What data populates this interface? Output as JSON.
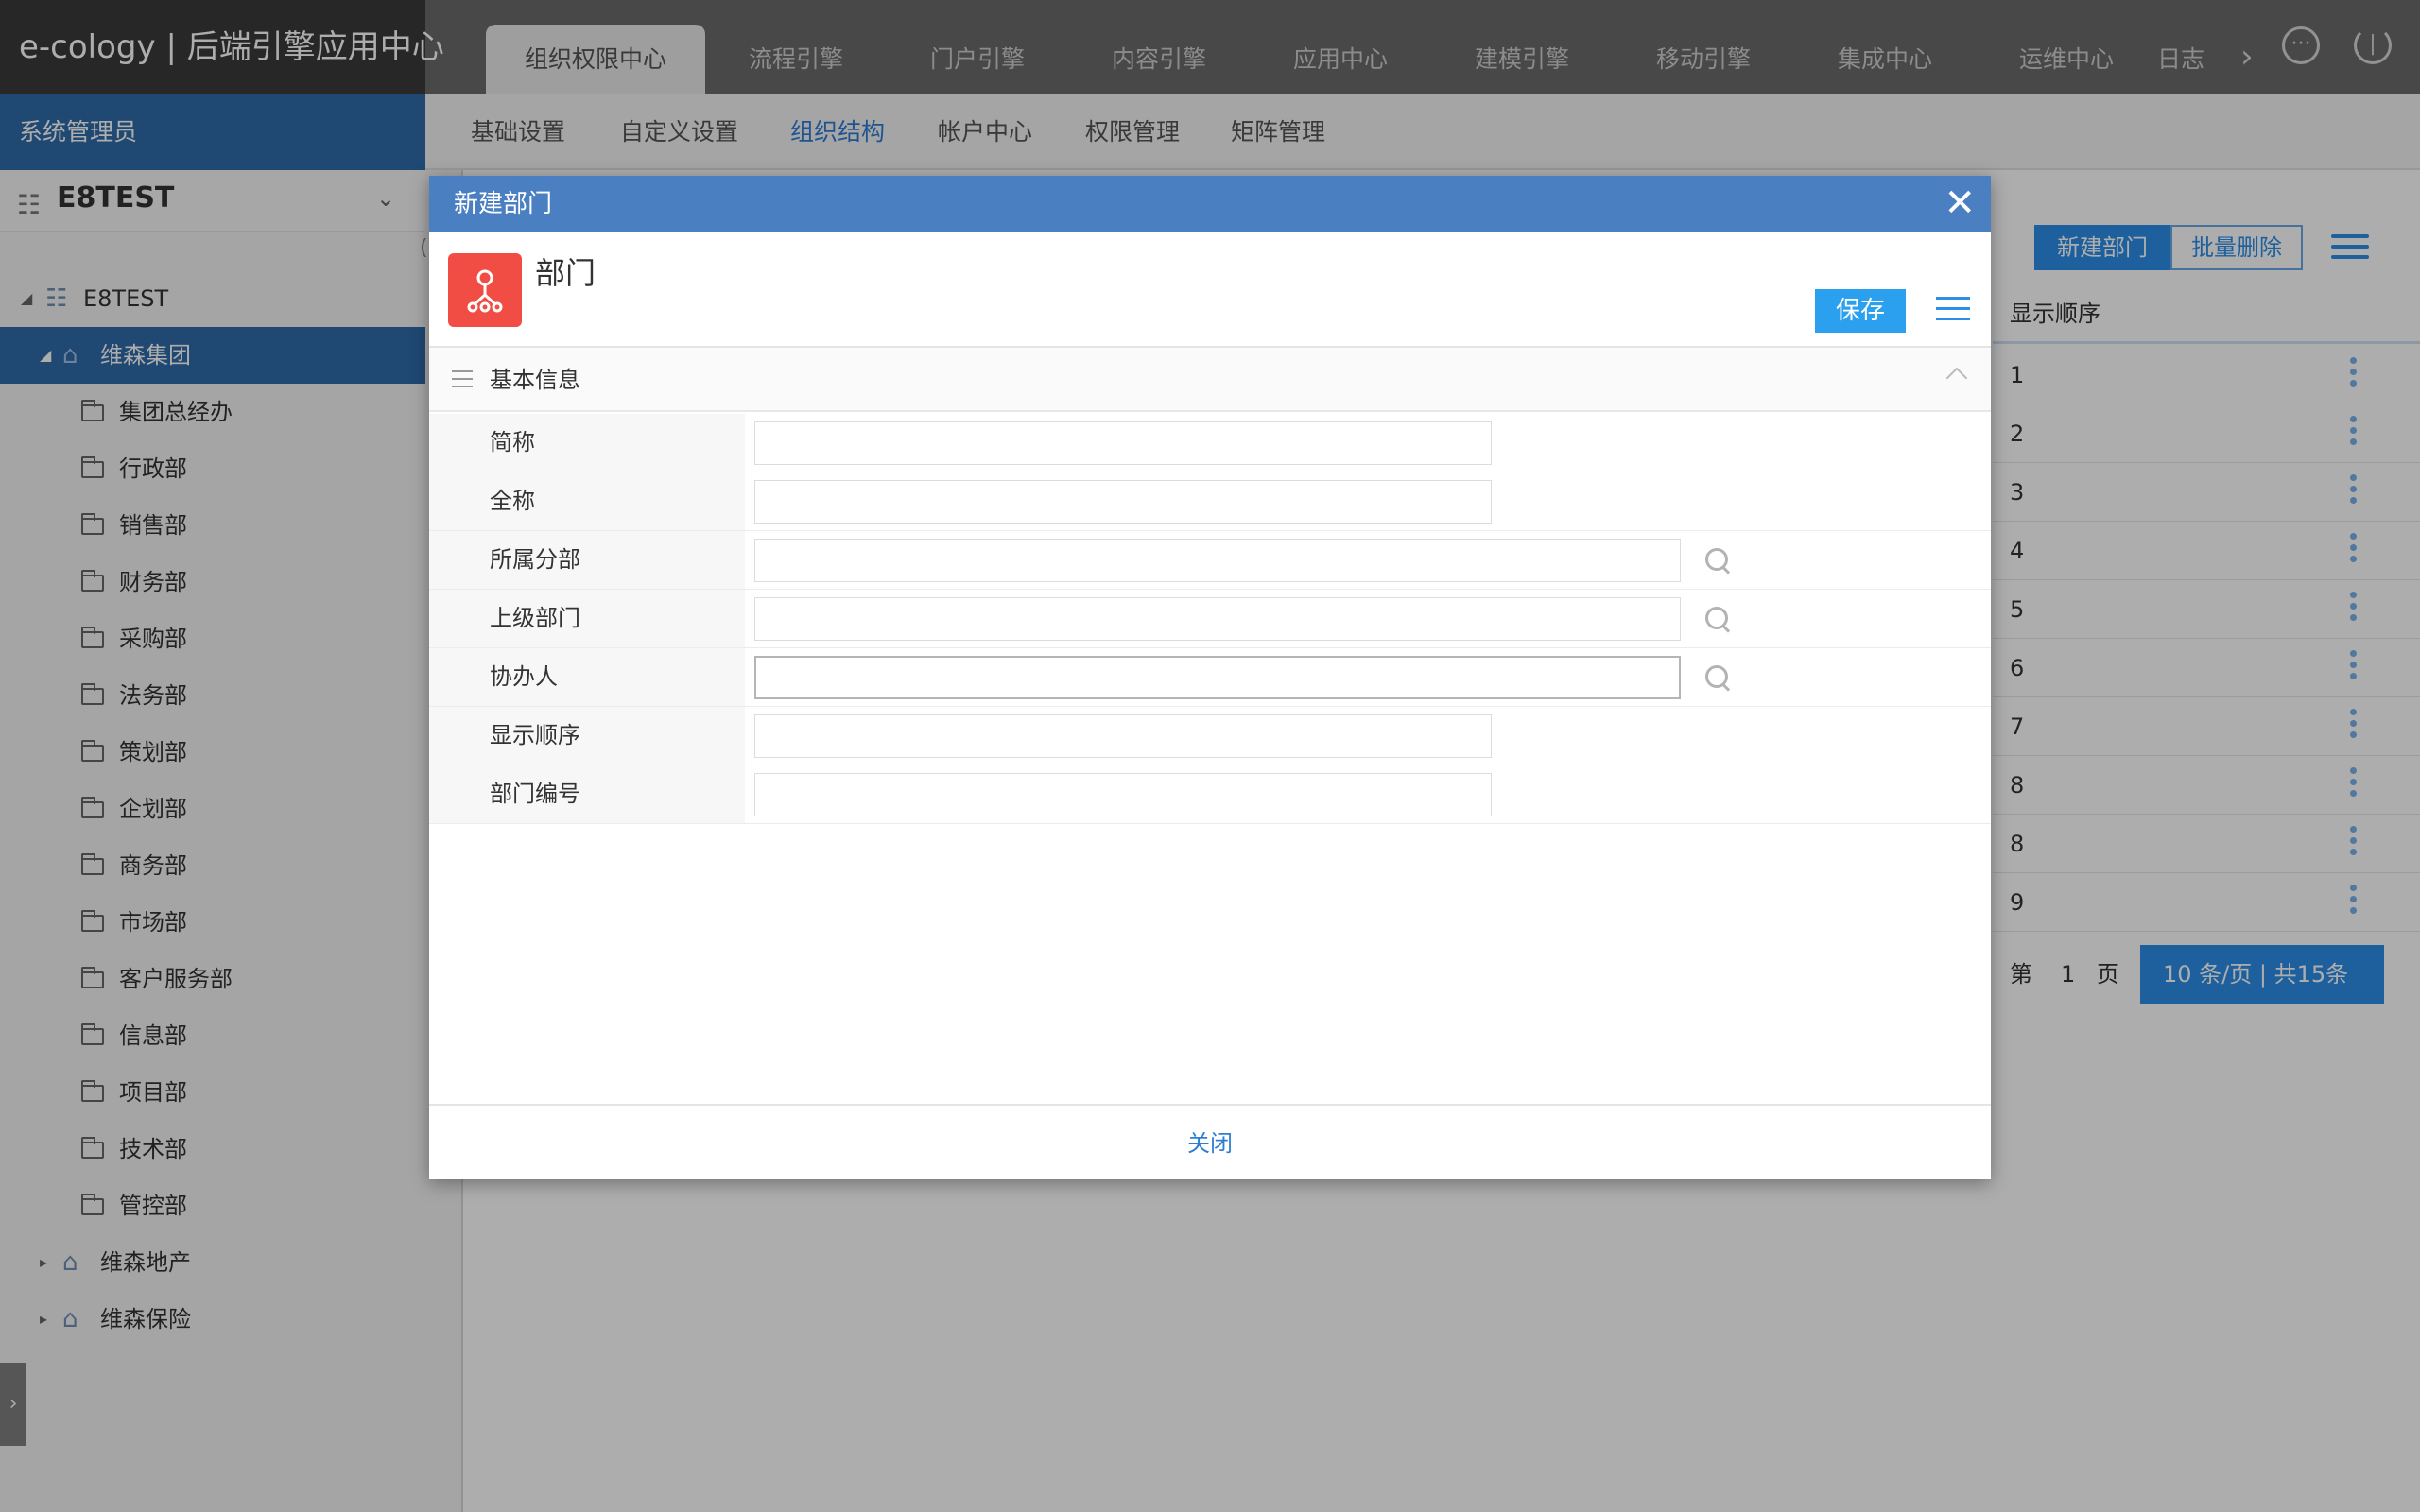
{
  "app": {
    "title": "e-cology | 后端引擎应用中心"
  },
  "topnav": {
    "tabs": [
      {
        "label": "组织权限中心",
        "active": true
      },
      {
        "label": "流程引擎"
      },
      {
        "label": "门户引擎"
      },
      {
        "label": "内容引擎"
      },
      {
        "label": "应用中心"
      },
      {
        "label": "建模引擎"
      },
      {
        "label": "移动引擎"
      },
      {
        "label": "集成中心"
      },
      {
        "label": "运维中心"
      },
      {
        "label": "日志"
      }
    ],
    "more_glyph": "›"
  },
  "sidebar": {
    "user_role": "系统管理员",
    "company": "E8TEST",
    "tree": [
      {
        "label": "E8TEST",
        "level": 0,
        "type": "org",
        "arrow": "◢"
      },
      {
        "label": "维森集团",
        "level": 1,
        "type": "home",
        "arrow": "◢",
        "selected": true
      },
      {
        "label": "集团总经办",
        "level": 2,
        "type": "folder"
      },
      {
        "label": "行政部",
        "level": 2,
        "type": "folder"
      },
      {
        "label": "销售部",
        "level": 2,
        "type": "folder"
      },
      {
        "label": "财务部",
        "level": 2,
        "type": "folder"
      },
      {
        "label": "采购部",
        "level": 2,
        "type": "folder"
      },
      {
        "label": "法务部",
        "level": 2,
        "type": "folder"
      },
      {
        "label": "策划部",
        "level": 2,
        "type": "folder"
      },
      {
        "label": "企划部",
        "level": 2,
        "type": "folder"
      },
      {
        "label": "商务部",
        "level": 2,
        "type": "folder"
      },
      {
        "label": "市场部",
        "level": 2,
        "type": "folder"
      },
      {
        "label": "客户服务部",
        "level": 2,
        "type": "folder"
      },
      {
        "label": "信息部",
        "level": 2,
        "type": "folder"
      },
      {
        "label": "项目部",
        "level": 2,
        "type": "folder"
      },
      {
        "label": "技术部",
        "level": 2,
        "type": "folder"
      },
      {
        "label": "管控部",
        "level": 2,
        "type": "folder"
      },
      {
        "label": "维森地产",
        "level": 1,
        "type": "home",
        "arrow": "▸"
      },
      {
        "label": "维森保险",
        "level": 1,
        "type": "home",
        "arrow": "▸"
      }
    ]
  },
  "subnav": {
    "items": [
      {
        "label": "基础设置"
      },
      {
        "label": "自定义设置"
      },
      {
        "label": "组织结构",
        "active": true
      },
      {
        "label": "帐户中心"
      },
      {
        "label": "权限管理"
      },
      {
        "label": "矩阵管理"
      }
    ]
  },
  "main": {
    "new_dept_label": "新建部门",
    "batch_delete_label": "批量删除",
    "column_header": "显示顺序",
    "rows": [
      "1",
      "2",
      "3",
      "4",
      "5",
      "6",
      "7",
      "8",
      "8",
      "9"
    ],
    "pager": {
      "prefix": "第",
      "page": "1",
      "suffix": "页",
      "page_size_text": "10   条/页 | 共15条"
    }
  },
  "modal": {
    "title": "新建部门",
    "entity_title": "部门",
    "save_label": "保存",
    "section_title": "基本信息",
    "fields": [
      {
        "label": "简称",
        "value": "",
        "kind": "text"
      },
      {
        "label": "全称",
        "value": "",
        "kind": "text"
      },
      {
        "label": "所属分部",
        "value": "",
        "kind": "browse"
      },
      {
        "label": "上级部门",
        "value": "",
        "kind": "browse"
      },
      {
        "label": "协办人",
        "value": "",
        "kind": "browse",
        "focused": true
      },
      {
        "label": "显示顺序",
        "value": "",
        "kind": "text"
      },
      {
        "label": "部门编号",
        "value": "",
        "kind": "text"
      }
    ],
    "close_label": "关闭"
  },
  "colors": {
    "brand_dark": "#3a3a3a",
    "topbar": "#6b6b6b",
    "sidebar_selected": "#2e6aa8",
    "modal_header": "#4a7fc1",
    "primary_button": "#2ba0ee",
    "dept_badge": "#f14d44",
    "link": "#2b7fd0"
  },
  "icons": {
    "more_options": "ellipsis-circle-icon",
    "power": "power-icon",
    "close": "close-icon",
    "list_menu": "list-icon",
    "search": "search-icon",
    "folder": "folder-icon",
    "org": "org-chart-icon",
    "home": "home-icon"
  }
}
